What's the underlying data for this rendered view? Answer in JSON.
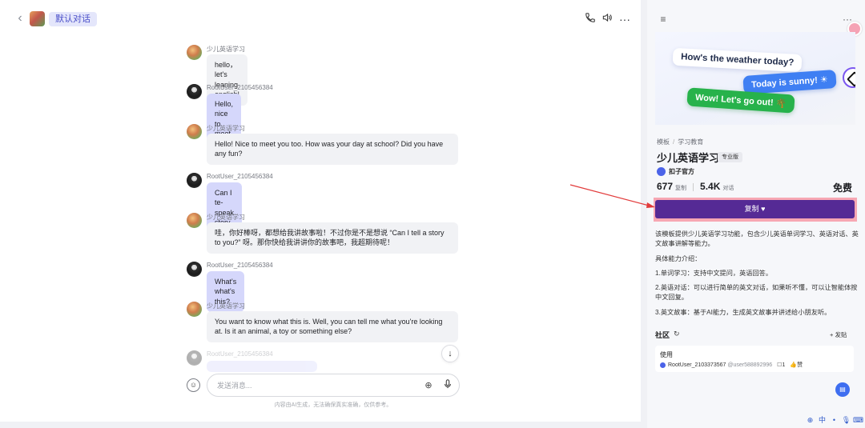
{
  "header": {
    "back_icon": "chevron-left-icon",
    "conversation_tag": "默认对话",
    "icons": [
      "phone-icon",
      "speaker-icon",
      "more-icon"
    ]
  },
  "messages": [
    {
      "sender": "少儿英语学习",
      "role": "bot",
      "text": "hello，let's leaning english!"
    },
    {
      "sender": "RootUser_2105456384",
      "role": "user",
      "text": "Hello, nice to meet you."
    },
    {
      "sender": "少儿英语学习",
      "role": "bot",
      "text": "Hello! Nice to meet you too. How was your day at school? Did you have any fun?"
    },
    {
      "sender": "RootUser_2105456384",
      "role": "user",
      "text": "Can I te- speak story to you?"
    },
    {
      "sender": "少儿英语学习",
      "role": "bot",
      "text": "哇，你好棒呀，都想给我讲故事啦！不过你是不是想说 “Can I tell a story to you?” 呀。那你快给我讲讲你的故事吧，我超期待呢！"
    },
    {
      "sender": "RootUser_2105456384",
      "role": "user",
      "text": "What's what's this?"
    },
    {
      "sender": "少儿英语学习",
      "role": "bot",
      "text": "You want to know what this is. Well, you can tell me what you're looking at. Is it an animal, a toy or something else?"
    },
    {
      "sender": "RootUser_2105456384",
      "role": "user",
      "text": ""
    }
  ],
  "composer": {
    "placeholder": "发送消息...",
    "disclaimer": "内容由AI生成，无法确保真实准确，仅供参考。"
  },
  "side": {
    "banner": {
      "line1": "How's the weather today?",
      "line2": "Today is sunny! ☀",
      "line3": "Wow! Let's go out! 🌴"
    },
    "breadcrumb": [
      "模板",
      "学习教育"
    ],
    "title": "少儿英语学习",
    "edition": "专业版",
    "author": "扣子官方",
    "copies": "677",
    "copies_label": "复制",
    "conversations": "5.4K",
    "conversations_label": "对话",
    "price": "免费",
    "copy_button": "复制 ♥",
    "description": [
      "该模板提供少儿英语学习功能，包含少儿英语单词学习、英语对话、英文故事讲解等能力。",
      "具体能力介绍：",
      "1.单词学习：支持中文提问，英语回答。",
      "2.英语对话：可以进行简单的英文对话，如果听不懂，可以让智能体按中文回复。",
      "3.英文故事：基于AI能力，生成英文故事并讲述给小朋友听。"
    ],
    "community_title": "社区",
    "post_button": "+ 发贴",
    "post": {
      "title": "使用",
      "author": "RootUser_2103373567",
      "handle": "@user588892996",
      "comments": "1",
      "likes_label": "赞"
    }
  },
  "ime": [
    "中",
    "•",
    "🎙",
    "⌨"
  ],
  "colors": {
    "accent": "#552a95",
    "user_bubble": "#d5d7fb",
    "bot_bubble": "#f1f2f5",
    "tag_bg": "#e4e6fb",
    "annotation": "#e23b3b"
  }
}
